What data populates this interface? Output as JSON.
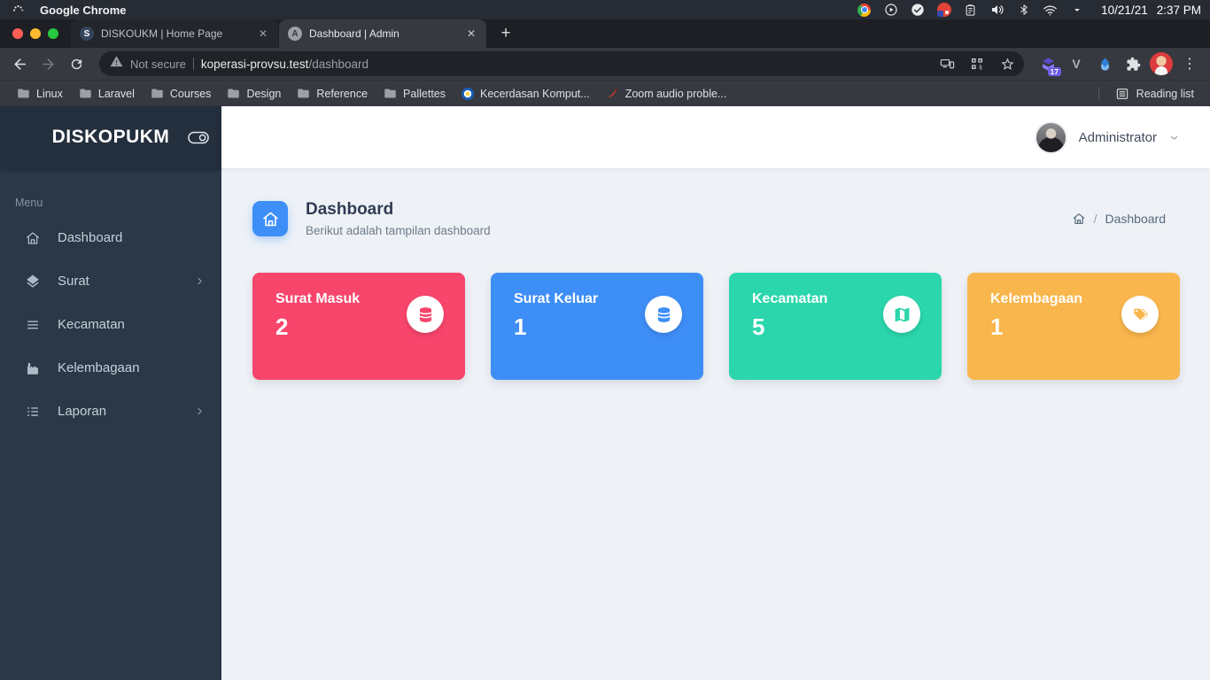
{
  "system_bar": {
    "app_name": "Google Chrome",
    "date": "10/21/21",
    "time": "2:37 PM"
  },
  "browser": {
    "tabs": [
      {
        "title": "DISKOUKM | Home Page",
        "favicon_letter": "S",
        "active": false
      },
      {
        "title": "Dashboard | Admin",
        "favicon_letter": "A",
        "active": true
      }
    ],
    "address": {
      "security_label": "Not secure",
      "host": "koperasi-provsu.test",
      "path": "/dashboard"
    },
    "extensions_badge": "17",
    "extension_v_label": "V",
    "bookmarks": [
      {
        "label": "Linux",
        "type": "folder"
      },
      {
        "label": "Laravel",
        "type": "folder"
      },
      {
        "label": "Courses",
        "type": "folder"
      },
      {
        "label": "Design",
        "type": "folder"
      },
      {
        "label": "Reference",
        "type": "folder"
      },
      {
        "label": "Pallettes",
        "type": "folder"
      },
      {
        "label": "Kecerdasan Komput...",
        "type": "site"
      },
      {
        "label": "Zoom audio proble...",
        "type": "site"
      }
    ],
    "reading_list_label": "Reading list"
  },
  "app": {
    "brand": "DISKOPUKM",
    "menu_section_label": "Menu",
    "menu": [
      {
        "label": "Dashboard",
        "icon": "home",
        "expandable": false
      },
      {
        "label": "Surat",
        "icon": "layers",
        "expandable": true
      },
      {
        "label": "Kecamatan",
        "icon": "list",
        "expandable": false
      },
      {
        "label": "Kelembagaan",
        "icon": "building-chart",
        "expandable": false
      },
      {
        "label": "Laporan",
        "icon": "tasks",
        "expandable": true
      }
    ],
    "user": {
      "name": "Administrator"
    },
    "page": {
      "title": "Dashboard",
      "subtitle": "Berikut adalah tampilan dashboard",
      "breadcrumb_separator": "/",
      "breadcrumb_current": "Dashboard",
      "icon_bg": "#3e8ef7"
    },
    "cards": [
      {
        "label": "Surat Masuk",
        "value": "2",
        "color": "#f8456c",
        "icon": "database"
      },
      {
        "label": "Surat Keluar",
        "value": "1",
        "color": "#3e8ef7",
        "icon": "database"
      },
      {
        "label": "Kecamatan",
        "value": "5",
        "color": "#2bd6ac",
        "icon": "map"
      },
      {
        "label": "Kelembagaan",
        "value": "1",
        "color": "#f8b64c",
        "icon": "tags"
      }
    ]
  }
}
